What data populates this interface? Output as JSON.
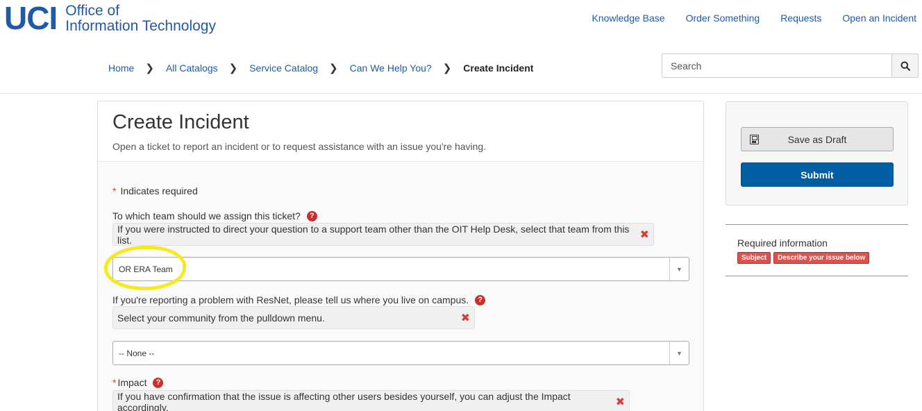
{
  "header": {
    "logo_mark": "UCI",
    "logo_line1": "Office of",
    "logo_line2": "Information Technology",
    "nav": [
      "Knowledge Base",
      "Order Something",
      "Requests",
      "Open an Incident"
    ]
  },
  "breadcrumb": {
    "items": [
      "Home",
      "All Catalogs",
      "Service Catalog",
      "Can We Help You?"
    ],
    "current": "Create Incident"
  },
  "search": {
    "placeholder": "Search",
    "icon": "search-icon"
  },
  "form": {
    "title": "Create Incident",
    "subtitle": "Open a ticket to report an incident or to request assistance with an issue you're having.",
    "required_note": "Indicates required",
    "fields": [
      {
        "label": "To which team should we assign this ticket?",
        "hint": "If you were instructed to direct your question to a support team other than the OIT Help Desk, select that team from this list.",
        "value": "OR ERA Team",
        "required": false
      },
      {
        "label": "If you're reporting a problem with ResNet, please tell us where you live on campus.",
        "hint": "Select your community from the pulldown menu.",
        "value": "-- None --",
        "required": false
      },
      {
        "label": "Impact",
        "hint": "If you have confirmation that the issue is affecting other users besides yourself, you can adjust the Impact accordingly.",
        "required": true
      }
    ]
  },
  "sidebar": {
    "save_draft": "Save as Draft",
    "submit": "Submit",
    "required_info_title": "Required information",
    "required_badges": [
      "Subject",
      "Describe your issue below"
    ]
  },
  "colors": {
    "brand": "#1f5aa6",
    "submit": "#005ea2",
    "required": "#d9534f",
    "highlight": "#f5ea1a"
  }
}
